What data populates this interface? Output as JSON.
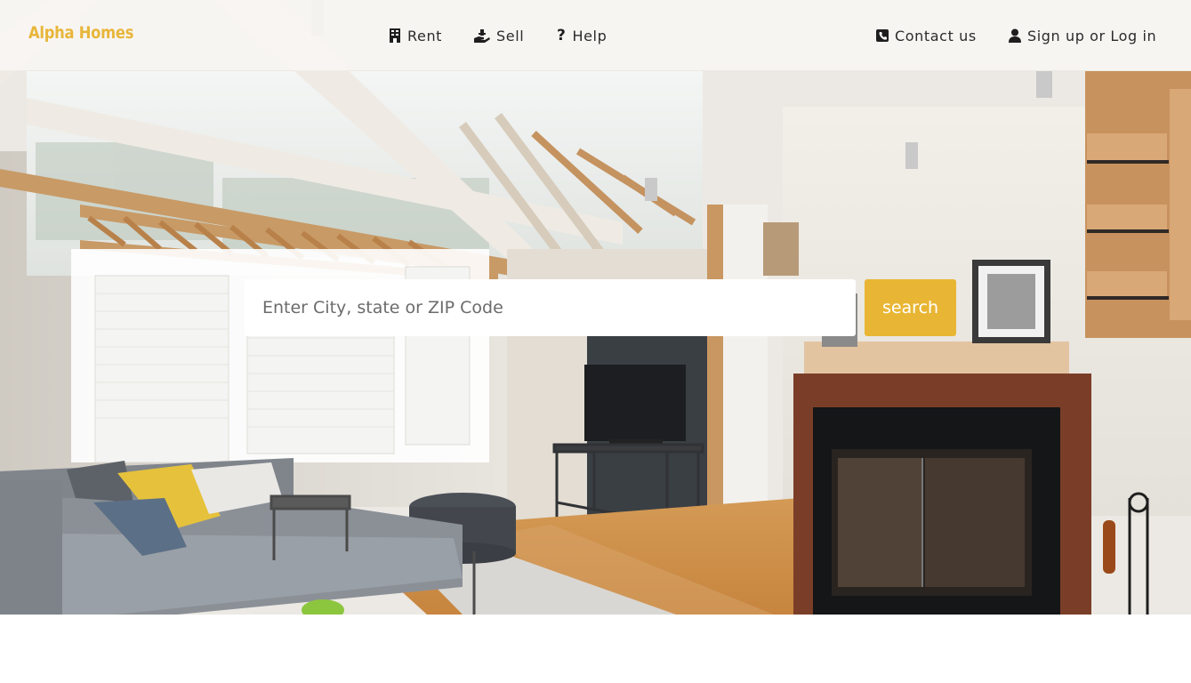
{
  "brand": {
    "name": "Alpha Homes",
    "color": "#e8b63a"
  },
  "nav": {
    "left": [
      {
        "label": "Rent",
        "icon": "building-icon"
      },
      {
        "label": "Sell",
        "icon": "hand-holding-icon"
      },
      {
        "label": "Help",
        "icon": "question-icon"
      }
    ],
    "right": [
      {
        "label": "Contact us",
        "icon": "phone-square-icon"
      },
      {
        "label": "Sign up or Log in",
        "icon": "user-icon"
      }
    ]
  },
  "search": {
    "placeholder": "Enter City, state or ZIP Code",
    "value": "",
    "button_label": "search",
    "button_color": "#e8b634"
  },
  "hero": {
    "image": "living-room-photo"
  }
}
